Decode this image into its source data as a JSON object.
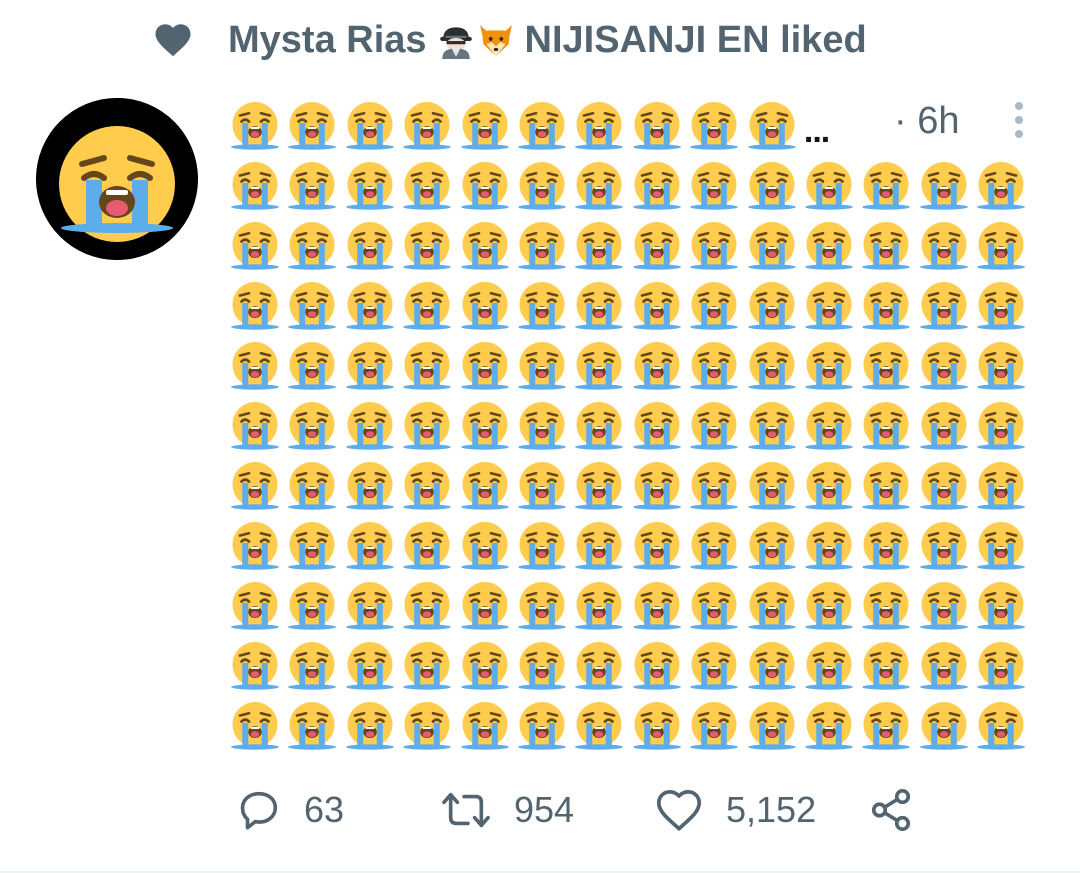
{
  "social_context": {
    "icon": "heart-icon",
    "user_name": "Mysta Rias",
    "emojis": [
      "detective-emoji",
      "fox-emoji"
    ],
    "suffix": "NIJISANJI EN liked"
  },
  "tweet": {
    "avatar": "loudly-crying-face-avatar",
    "emoji_name": "loudly-crying-face",
    "first_row_emoji_count": 10,
    "first_row_truncation": "...",
    "row_count": 11,
    "full_row_emoji_count": 14,
    "timestamp": "· 6h",
    "more_icon": "more-vertical-icon"
  },
  "actions": {
    "reply": {
      "icon": "reply-icon",
      "count": "63"
    },
    "retweet": {
      "icon": "retweet-icon",
      "count": "954"
    },
    "like": {
      "icon": "heart-outline-icon",
      "count": "5,152"
    },
    "share": {
      "icon": "share-icon"
    }
  },
  "colors": {
    "text_secondary": "#536471",
    "emoji_face": "#FFCC4D",
    "emoji_tears": "#5DADEC"
  }
}
